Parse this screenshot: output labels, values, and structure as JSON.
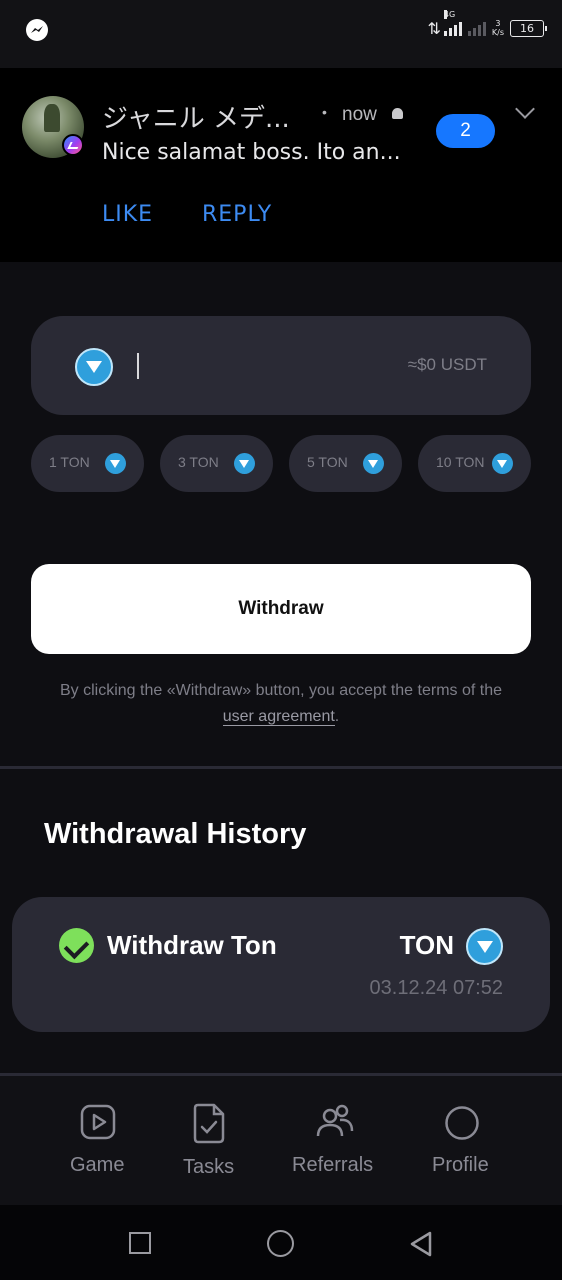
{
  "status_bar": {
    "network": "4G",
    "speed_value": "3",
    "speed_unit": "K/s",
    "battery": "16"
  },
  "notification": {
    "sender": "ジャニル メデ...",
    "separator": "•",
    "time": "now",
    "message": "Nice salamat boss. Ito an...",
    "count": "2",
    "actions": {
      "like": "LIKE",
      "reply": "REPLY"
    }
  },
  "withdraw_form": {
    "amount_value": "",
    "usdt_estimate": "≈$0 USDT",
    "presets": [
      "1 TON",
      "3 TON",
      "5 TON",
      "10 TON"
    ],
    "withdraw_label": "Withdraw",
    "terms_text": "By clicking the «Withdraw» button, you accept the terms of the",
    "terms_link": "user agreement",
    "terms_period": "."
  },
  "history": {
    "title": "Withdrawal History",
    "items": [
      {
        "label": "Withdraw Ton",
        "currency": "TON",
        "datetime": "03.12.24 07:52",
        "status": "completed"
      }
    ]
  },
  "nav": {
    "items": [
      {
        "label": "Game",
        "icon": "play-icon"
      },
      {
        "label": "Tasks",
        "icon": "document-check-icon"
      },
      {
        "label": "Referrals",
        "icon": "users-icon"
      },
      {
        "label": "Profile",
        "icon": "profile-circle-icon"
      }
    ]
  },
  "colors": {
    "background": "#0e0e12",
    "card": "#2a2a35",
    "ton_blue": "#2f9fdc",
    "notification_accent": "#1677ff",
    "success": "#7ee05b"
  }
}
